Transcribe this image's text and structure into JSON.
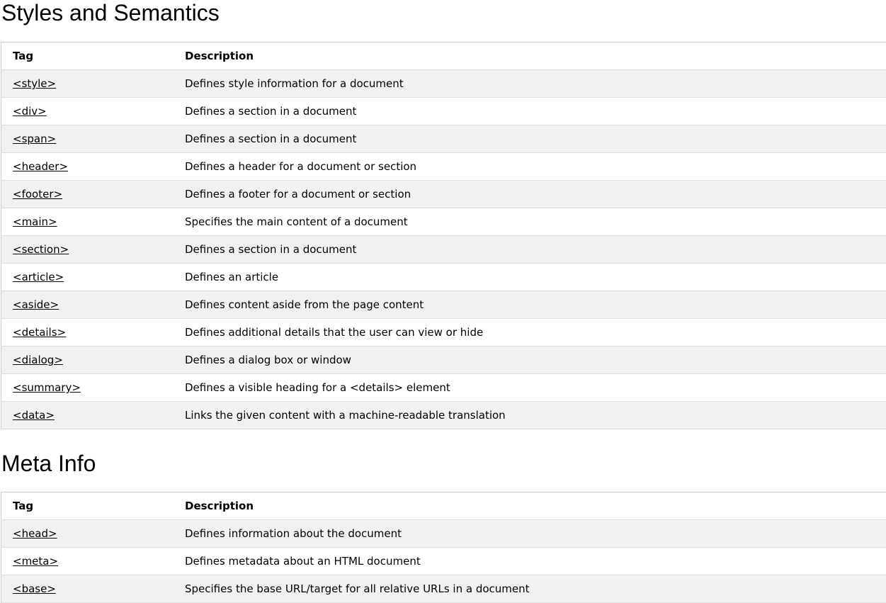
{
  "sections": [
    {
      "title": "Styles and Semantics",
      "headers": {
        "tag": "Tag",
        "description": "Description"
      },
      "rows": [
        {
          "tag": "<style>",
          "description": "Defines style information for a document"
        },
        {
          "tag": "<div>",
          "description": "Defines a section in a document"
        },
        {
          "tag": "<span>",
          "description": "Defines a section in a document"
        },
        {
          "tag": "<header>",
          "description": "Defines a header for a document or section"
        },
        {
          "tag": "<footer>",
          "description": "Defines a footer for a document or section"
        },
        {
          "tag": "<main>",
          "description": "Specifies the main content of a document"
        },
        {
          "tag": "<section>",
          "description": "Defines a section in a document"
        },
        {
          "tag": "<article>",
          "description": "Defines an article"
        },
        {
          "tag": "<aside>",
          "description": "Defines content aside from the page content"
        },
        {
          "tag": "<details>",
          "description": "Defines additional details that the user can view or hide"
        },
        {
          "tag": "<dialog>",
          "description": "Defines a dialog box or window"
        },
        {
          "tag": "<summary>",
          "description": "Defines a visible heading for a <details> element"
        },
        {
          "tag": "<data>",
          "description": "Links the given content with a machine-readable translation"
        }
      ]
    },
    {
      "title": "Meta Info",
      "headers": {
        "tag": "Tag",
        "description": "Description"
      },
      "rows": [
        {
          "tag": "<head>",
          "description": "Defines information about the document"
        },
        {
          "tag": "<meta>",
          "description": "Defines metadata about an HTML document"
        },
        {
          "tag": "<base>",
          "description": "Specifies the base URL/target for all relative URLs in a document"
        }
      ]
    }
  ]
}
